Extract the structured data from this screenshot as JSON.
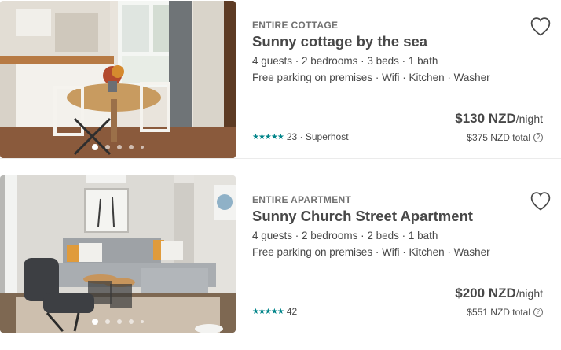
{
  "listings": [
    {
      "kind": "ENTIRE COTTAGE",
      "title": "Sunny cottage by the sea",
      "details": "4 guests · 2 bedrooms · 3 beds · 1 bath",
      "amenities": "Free parking on premises · Wifi · Kitchen · Washer",
      "stars": "★★★★★",
      "rating_text": "23 · Superhost",
      "price": "$130 NZD",
      "price_unit": "/night",
      "total": "$375 NZD total",
      "help_icon": "?",
      "photo_index": 0,
      "photo_count": 5
    },
    {
      "kind": "ENTIRE APARTMENT",
      "title": "Sunny Church Street Apartment",
      "details": "4 guests · 2 bedrooms · 2 beds · 1 bath",
      "amenities": "Free parking on premises · Wifi · Kitchen · Washer",
      "stars": "★★★★★",
      "rating_text": "42",
      "price": "$200 NZD",
      "price_unit": "/night",
      "total": "$551 NZD total",
      "help_icon": "?",
      "photo_index": 0,
      "photo_count": 5
    }
  ],
  "colors": {
    "accent": "#008489",
    "text": "#484848",
    "muted": "#717171",
    "divider": "#ebebeb"
  }
}
